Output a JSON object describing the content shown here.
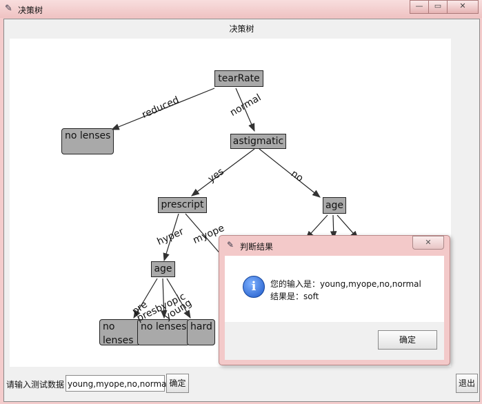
{
  "window": {
    "title": "决策树",
    "min_label": "—",
    "max_label": "▭",
    "close_label": "✕"
  },
  "frame_label": "决策树",
  "tree": {
    "nodes": {
      "root": "tearRate",
      "no_lenses_1": "no lenses",
      "astigmatic": "astigmatic",
      "prescript": "prescript",
      "age_right": "age",
      "age_left": "age",
      "no_lenses_2": "no lenses",
      "no_lenses_3": "no lenses",
      "hard": "hard"
    },
    "edges": {
      "reduced": "reduced",
      "normal": "normal",
      "yes": "yes",
      "no": "no",
      "hyper": "hyper",
      "myope": "myope",
      "pre": "pre",
      "presbyopic": "presbyopic",
      "young": "young"
    }
  },
  "bottom": {
    "prompt_label": "请输入测试数据",
    "input_value": "young,myope,no,normal",
    "confirm_label": "确定",
    "exit_label": "退出"
  },
  "dialog": {
    "title": "判断结果",
    "close_label": "✕",
    "line1": "您的输入是：young,myope,no,normal",
    "line2": "结果是：soft",
    "ok_label": "确定",
    "info_glyph": "i"
  }
}
